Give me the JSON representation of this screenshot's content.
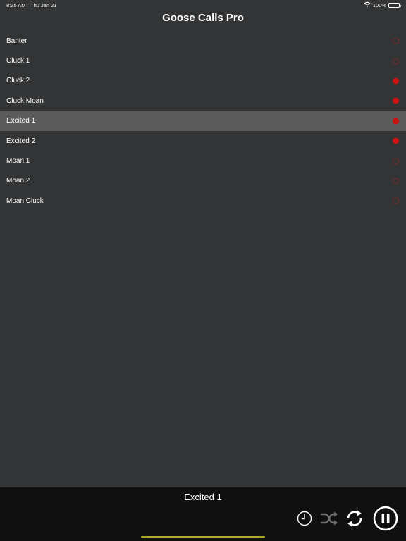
{
  "status_bar": {
    "time": "8:35 AM",
    "date": "Thu Jan 21",
    "battery": "100%"
  },
  "app_title": "Goose Calls Pro",
  "calls": [
    {
      "label": "Banter",
      "active": false,
      "selected": false
    },
    {
      "label": "Cluck 1",
      "active": false,
      "selected": false
    },
    {
      "label": "Cluck 2",
      "active": true,
      "selected": false
    },
    {
      "label": "Cluck Moan",
      "active": true,
      "selected": false
    },
    {
      "label": "Excited 1",
      "active": true,
      "selected": true
    },
    {
      "label": "Excited 2",
      "active": true,
      "selected": false
    },
    {
      "label": "Moan 1",
      "active": false,
      "selected": false
    },
    {
      "label": "Moan 2",
      "active": false,
      "selected": false
    },
    {
      "label": "Moan Cluck",
      "active": false,
      "selected": false
    }
  ],
  "player": {
    "now_playing": "Excited 1"
  },
  "colors": {
    "background": "#333435",
    "selected_row": "#5b5b5b",
    "active_dot": "#c91414",
    "player_bar": "#101010",
    "home_indicator": "#b1ad2a"
  },
  "icons": {
    "timer": "clock-icon",
    "shuffle": "shuffle-icon",
    "repeat": "repeat-icon",
    "pause": "pause-icon"
  }
}
